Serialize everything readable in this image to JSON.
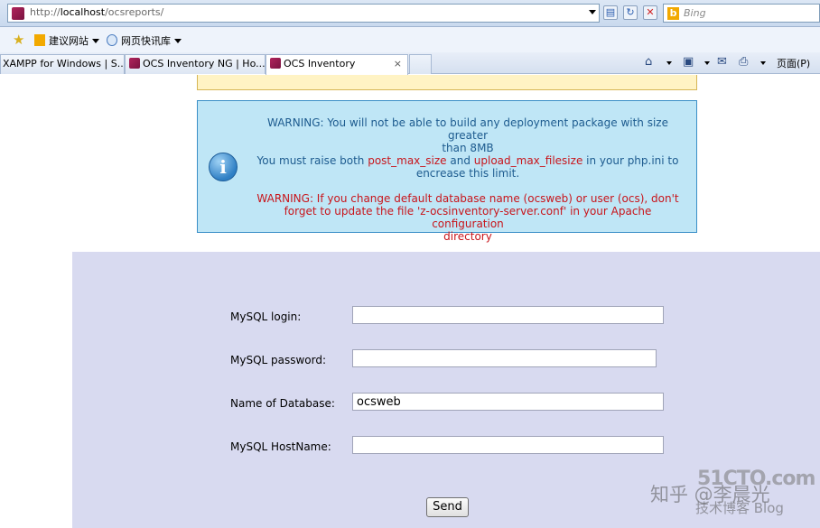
{
  "browser": {
    "url_prefix": "http://",
    "url_host": "localhost",
    "url_path": "/ocsreports/",
    "search_placeholder": "Bing",
    "bing_mark": "b",
    "favorites": [
      {
        "label": "建议网站"
      },
      {
        "label": "网页快讯库"
      }
    ],
    "tabs": [
      {
        "label": "XAMPP for Windows | S..."
      },
      {
        "label": "OCS Inventory NG | Ho..."
      },
      {
        "label": "OCS Inventory"
      }
    ],
    "tab_close": "×",
    "page_menu": "页面(P)"
  },
  "warning": {
    "line1a": "WARNING: You will not be able to build any deployment package with size greater",
    "line1b": "than 8MB",
    "line2_pre": "You must raise both ",
    "line2_var1": "post_max_size",
    "line2_mid": " and ",
    "line2_var2": "upload_max_filesize",
    "line2_post": " in your php.ini to",
    "line3": "encrease this limit.",
    "db_warning_1": "WARNING: If you change default database name (ocsweb) or user (ocs), don't",
    "db_warning_2": "forget to update the file 'z-ocsinventory-server.conf' in your Apache configuration",
    "db_warning_3": "directory",
    "icon_glyph": "i"
  },
  "form": {
    "fields": [
      {
        "label": "MySQL login:",
        "value": ""
      },
      {
        "label": "MySQL password:",
        "value": ""
      },
      {
        "label": "Name of Database:",
        "value": "ocsweb"
      },
      {
        "label": "MySQL HostName:",
        "value": ""
      }
    ],
    "submit_label": "Send"
  },
  "watermark": {
    "site": "51CTO.com",
    "author": "知乎 @李晨光",
    "sub": "技术博客  Blog"
  },
  "colors": {
    "warning_blue_text": "#1d5b8f",
    "warning_red_text": "#c8151b",
    "info_box_bg": "#bfe6f6",
    "form_panel_bg": "#d8daf0"
  }
}
